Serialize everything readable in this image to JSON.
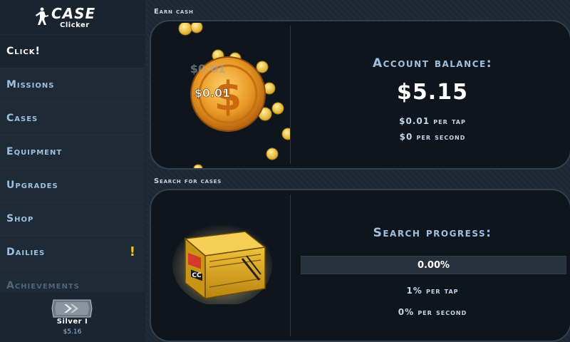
{
  "app": {
    "logo_title": "CASE",
    "logo_subtitle": "Clicker"
  },
  "sidebar": {
    "items": [
      {
        "label": "Click!",
        "active": true
      },
      {
        "label": "Missions"
      },
      {
        "label": "Cases"
      },
      {
        "label": "Equipment"
      },
      {
        "label": "Upgrades"
      },
      {
        "label": "Shop"
      },
      {
        "label": "Dailies",
        "alert": "!"
      },
      {
        "label": "Achievements"
      }
    ]
  },
  "rank": {
    "name": "Silver I",
    "money": "$5.16"
  },
  "earn": {
    "section_title": "Earn cash",
    "float_text_back": "$0.01",
    "float_text_front": "$0.01",
    "balance_title": "Account balance:",
    "balance_value": "$5.15",
    "per_tap": "$0.01 per tap",
    "per_second": "$0 per second"
  },
  "search": {
    "section_title": "Search for cases",
    "progress_title": "Search progress:",
    "progress_label": "0.00%",
    "progress_value": 0.0,
    "per_tap": "1% per tap",
    "per_second": "0% per second",
    "case_label": "CC"
  },
  "colors": {
    "accent": "#9ec0de",
    "gold": "#e8a21a",
    "alert": "#f2c81d",
    "panel_bg": "#0f151c"
  }
}
